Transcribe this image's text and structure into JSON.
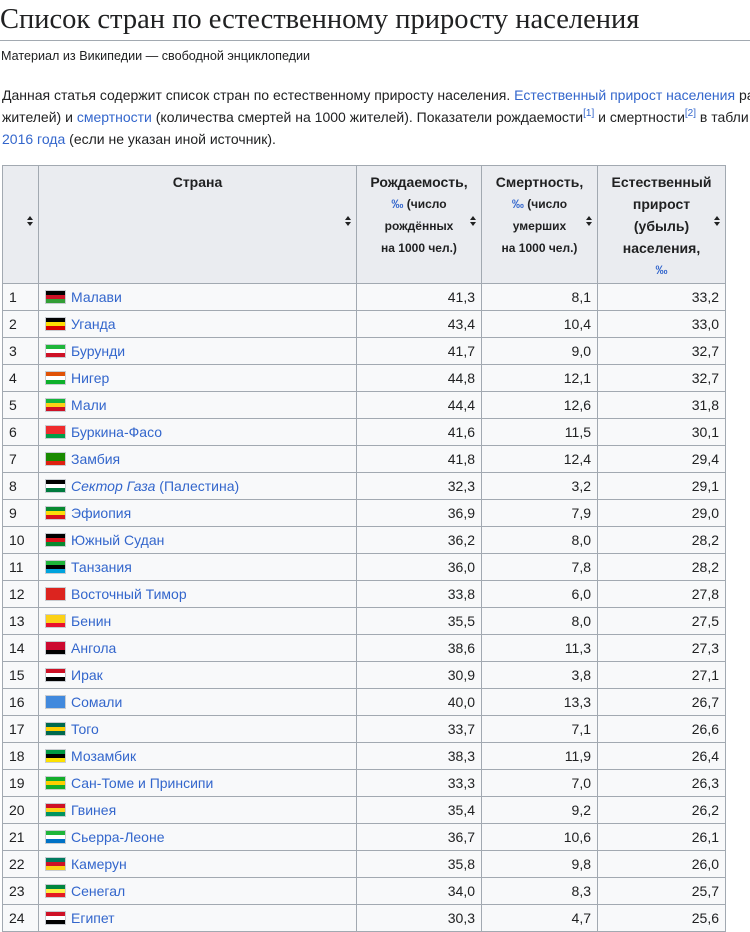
{
  "page": {
    "title": "Список стран по естественному приросту населения",
    "subtitle": "Материал из Википедии — свободной энциклопедии"
  },
  "intro": {
    "line1_text": "Данная статья содержит список стран по естественному приросту населения. ",
    "line1_link": "Естественный прирост населения",
    "line1_tail": " ра",
    "line2_text1": "жителей) и ",
    "line2_link": "смертности",
    "line2_text2": " (количества смертей на 1000 жителей). Показатели рождаемости",
    "line2_ref1": "[1]",
    "line2_text3": " и смертности",
    "line2_ref2": "[2]",
    "line2_text4": " в табли",
    "line3_link": "2016 года",
    "line3_text": " (если не указан иной источник)."
  },
  "table": {
    "headers": {
      "country": "Страна",
      "birth_label": "Рождаемость,",
      "birth_unit": "‰",
      "birth_l2": " (число",
      "birth_l3": "рождённых",
      "birth_l4": "на 1000 чел.)",
      "death_label": "Смертность,",
      "death_unit": "‰",
      "death_l2": " (число",
      "death_l3": "умерших",
      "death_l4": "на 1000 чел.)",
      "growth_l1": "Естественный",
      "growth_l2": "прирост",
      "growth_l3": "(убыль)",
      "growth_l4": "населения,",
      "growth_unit": "‰"
    },
    "rows": [
      {
        "rank": "1",
        "country": "Малави",
        "birth": "41,3",
        "death": "8,1",
        "growth": "33,2",
        "flag": [
          "#000000",
          "#ce1126",
          "#339e35"
        ]
      },
      {
        "rank": "2",
        "country": "Уганда",
        "birth": "43,4",
        "death": "10,4",
        "growth": "33,0",
        "flag": [
          "#000000",
          "#fcdc04",
          "#d90000"
        ]
      },
      {
        "rank": "3",
        "country": "Бурунди",
        "birth": "41,7",
        "death": "9,0",
        "growth": "32,7",
        "flag": [
          "#1eb53a",
          "#ffffff",
          "#ce1126"
        ]
      },
      {
        "rank": "4",
        "country": "Нигер",
        "birth": "44,8",
        "death": "12,1",
        "growth": "32,7",
        "flag": [
          "#e05206",
          "#ffffff",
          "#0db02b"
        ]
      },
      {
        "rank": "5",
        "country": "Мали",
        "birth": "44,4",
        "death": "12,6",
        "growth": "31,8",
        "flag": [
          "#14b53a",
          "#fcd116",
          "#ce1126"
        ]
      },
      {
        "rank": "6",
        "country": "Буркина-Фасо",
        "birth": "41,6",
        "death": "11,5",
        "growth": "30,1",
        "flag": [
          "#ef2b2d",
          "#ef2b2d",
          "#009e49"
        ]
      },
      {
        "rank": "7",
        "country": "Замбия",
        "birth": "41,8",
        "death": "12,4",
        "growth": "29,4",
        "flag": [
          "#198a00",
          "#198a00",
          "#de2010"
        ]
      },
      {
        "rank": "8",
        "country": "Сектор Газа",
        "country_suffix": " (Палестина)",
        "italic": true,
        "birth": "32,3",
        "death": "3,2",
        "growth": "29,1",
        "flag": [
          "#000000",
          "#ffffff",
          "#007a3d"
        ]
      },
      {
        "rank": "9",
        "country": "Эфиопия",
        "birth": "36,9",
        "death": "7,9",
        "growth": "29,0",
        "flag": [
          "#078930",
          "#fcdd09",
          "#da121a"
        ]
      },
      {
        "rank": "10",
        "country": "Южный Судан",
        "birth": "36,2",
        "death": "8,0",
        "growth": "28,2",
        "flag": [
          "#000000",
          "#da121a",
          "#078930"
        ]
      },
      {
        "rank": "11",
        "country": "Танзания",
        "birth": "36,0",
        "death": "7,8",
        "growth": "28,2",
        "flag": [
          "#1eb53a",
          "#000000",
          "#00a3dd"
        ]
      },
      {
        "rank": "12",
        "country": "Восточный Тимор",
        "birth": "33,8",
        "death": "6,0",
        "growth": "27,8",
        "flag": [
          "#dc241f",
          "#dc241f",
          "#dc241f"
        ]
      },
      {
        "rank": "13",
        "country": "Бенин",
        "birth": "35,5",
        "death": "8,0",
        "growth": "27,5",
        "flag": [
          "#fcd116",
          "#fcd116",
          "#e8112d"
        ]
      },
      {
        "rank": "14",
        "country": "Ангола",
        "birth": "38,6",
        "death": "11,3",
        "growth": "27,3",
        "flag": [
          "#cc092f",
          "#cc092f",
          "#000000"
        ]
      },
      {
        "rank": "15",
        "country": "Ирак",
        "birth": "30,9",
        "death": "3,8",
        "growth": "27,1",
        "flag": [
          "#ce1126",
          "#ffffff",
          "#000000"
        ]
      },
      {
        "rank": "16",
        "country": "Сомали",
        "birth": "40,0",
        "death": "13,3",
        "growth": "26,7",
        "flag": [
          "#4189dd",
          "#4189dd",
          "#4189dd"
        ]
      },
      {
        "rank": "17",
        "country": "Того",
        "birth": "33,7",
        "death": "7,1",
        "growth": "26,6",
        "flag": [
          "#006a4e",
          "#ffce00",
          "#006a4e"
        ]
      },
      {
        "rank": "18",
        "country": "Мозамбик",
        "birth": "38,3",
        "death": "11,9",
        "growth": "26,4",
        "flag": [
          "#009a44",
          "#000000",
          "#fce100"
        ]
      },
      {
        "rank": "19",
        "country": "Сан-Томе и Принсипи",
        "birth": "33,3",
        "death": "7,0",
        "growth": "26,3",
        "flag": [
          "#12ad2b",
          "#ffce00",
          "#12ad2b"
        ]
      },
      {
        "rank": "20",
        "country": "Гвинея",
        "birth": "35,4",
        "death": "9,2",
        "growth": "26,2",
        "flag": [
          "#ce1126",
          "#fcd116",
          "#009460"
        ]
      },
      {
        "rank": "21",
        "country": "Сьерра-Леоне",
        "birth": "36,7",
        "death": "10,6",
        "growth": "26,1",
        "flag": [
          "#1eb53a",
          "#ffffff",
          "#0072c6"
        ]
      },
      {
        "rank": "22",
        "country": "Камерун",
        "birth": "35,8",
        "death": "9,8",
        "growth": "26,0",
        "flag": [
          "#007a5e",
          "#ce1126",
          "#fcd116"
        ]
      },
      {
        "rank": "23",
        "country": "Сенегал",
        "birth": "34,0",
        "death": "8,3",
        "growth": "25,7",
        "flag": [
          "#00853f",
          "#fdef42",
          "#e31b23"
        ]
      },
      {
        "rank": "24",
        "country": "Египет",
        "birth": "30,3",
        "death": "4,7",
        "growth": "25,6",
        "flag": [
          "#ce1126",
          "#ffffff",
          "#000000"
        ]
      }
    ]
  }
}
